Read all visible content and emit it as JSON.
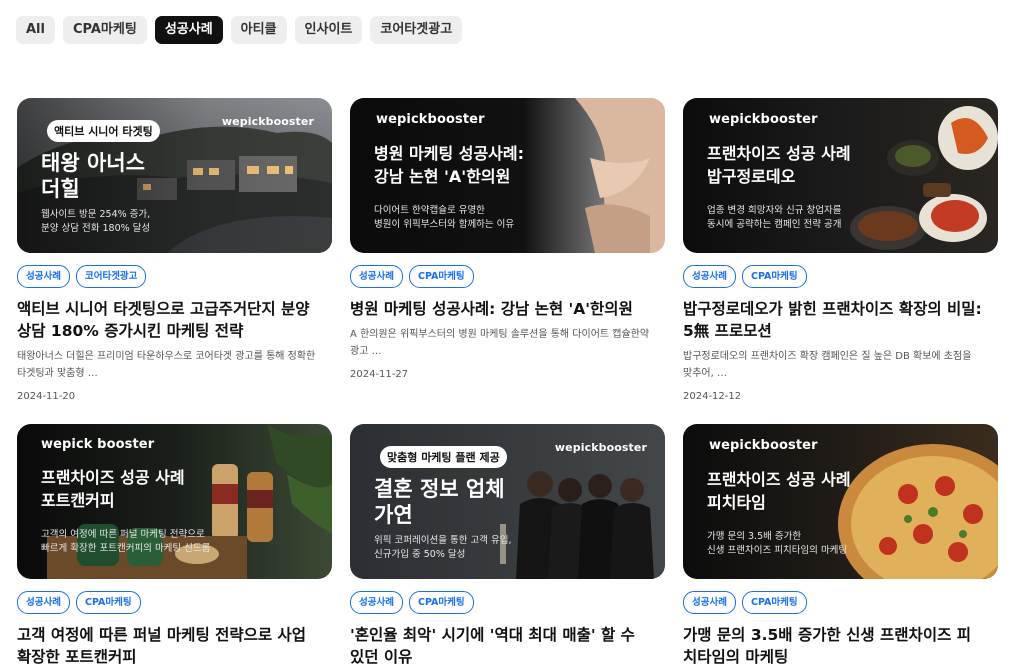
{
  "tabs": [
    {
      "label": "All",
      "active": false
    },
    {
      "label": "CPA마케팅",
      "active": false
    },
    {
      "label": "성공사례",
      "active": true
    },
    {
      "label": "아티클",
      "active": false
    },
    {
      "label": "인사이트",
      "active": false
    },
    {
      "label": "코어타겟광고",
      "active": false
    }
  ],
  "brand_logo": "wepickbooster",
  "brand_logo_alt": "wepick booster",
  "colors": {
    "tag_blue": "#1a6ef5",
    "active_tab": "#111111",
    "tab_bg": "#eeeeef"
  },
  "cards": [
    {
      "badge": "액티브 시니어 타겟팅",
      "headline_line1": "태왕 아너스",
      "headline_line2": "더힐",
      "caption_line1": "웹사이트 방문 254% 증가,",
      "caption_line2": "분양 상담 전화 180% 달성",
      "tags": [
        "성공사례",
        "코어타겟광고"
      ],
      "title": "액티브 시니어 타겟팅으로 고급주거단지 분양 상담 180% 증가시킨 마케팅 전략",
      "excerpt": "태왕아너스 더힐은 프리미엄 타운하우스로 코어타겟 광고를 통해 정확한 타겟팅과 맞춤형 …",
      "date": "2024-11-20"
    },
    {
      "headline_line1": "병원 마케팅 성공사례:",
      "headline_line2": "강남 논현 'A'한의원",
      "caption_line1": "다이어트 한약캡슐로 유명한",
      "caption_line2": "병원이 위픽부스터와 함께하는 이유",
      "tags": [
        "성공사례",
        "CPA마케팅"
      ],
      "title": "병원 마케팅 성공사례: 강남 논현 'A'한의원",
      "excerpt": "A 한의원은 위픽부스터의 병원 마케팅 솔루션을 통해 다이어트 캡슐한약 광고 …",
      "date": "2024-11-27"
    },
    {
      "headline_line1": "프랜차이즈 성공 사례",
      "headline_line2": "밥구정로데오",
      "caption_line1": "업종 변경 희망자와 신규 창업자를",
      "caption_line2": "동시에 공략하는 캠페인 전략 공개",
      "tags": [
        "성공사례",
        "CPA마케팅"
      ],
      "title": "밥구정로데오가 밝힌 프랜차이즈 확장의 비밀: 5無 프로모션",
      "excerpt": "밥구정로데오의 프랜차이즈 확장 캠페인은 질 높은 DB 확보에 초점을 맞추어, …",
      "date": "2024-12-12"
    },
    {
      "headline_line1": "프랜차이즈 성공 사례",
      "headline_line2": "포트캔커피",
      "caption_line1": "고객의 여정에 따른 퍼널 마케팅 전략으로",
      "caption_line2": "빠르게 확장한 포트캔커피의 마케팅 신드롬",
      "tags": [
        "성공사례",
        "CPA마케팅"
      ],
      "title": "고객 여정에 따른 퍼널 마케팅 전략으로 사업 확장한 포트캔커피"
    },
    {
      "badge": "맞춤형 마케팅 플랜 제공",
      "headline_line1": "결혼 정보 업체",
      "headline_line2": "가연",
      "caption_line1": "위픽 코퍼레이션을 통한 고객 유입,",
      "caption_line2": "신규가입 중 50% 달성",
      "tags": [
        "성공사례",
        "CPA마케팅"
      ],
      "title": "'혼인율 최악' 시기에 '역대 최대 매출' 할 수 있던 이유"
    },
    {
      "headline_line1": "프랜차이즈 성공 사례",
      "headline_line2": "피치타임",
      "caption_line1": "가맹 문의 3.5배 증가한",
      "caption_line2": "신생 프랜차이즈 피치타임의 마케팅",
      "tags": [
        "성공사례",
        "CPA마케팅"
      ],
      "title": "가맹 문의 3.5배 증가한 신생 프랜차이즈 피치타임의 마케팅"
    }
  ]
}
